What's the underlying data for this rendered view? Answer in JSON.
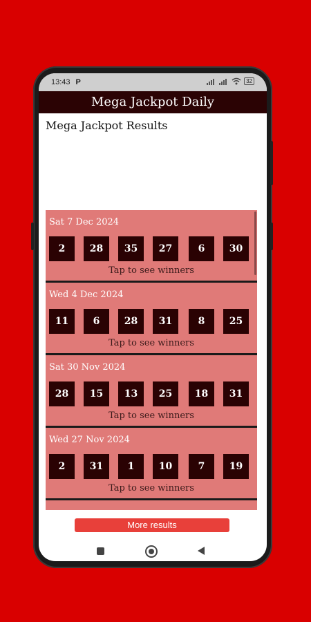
{
  "status_bar": {
    "time": "13:43",
    "indicator": "P",
    "battery": "32"
  },
  "app_bar": {
    "title": "Mega Jackpot Daily"
  },
  "main": {
    "section_title": "Mega Jackpot Results",
    "tap_hint": "Tap to see winners",
    "results": [
      {
        "date": "Sat 7 Dec 2024",
        "numbers": [
          "2",
          "28",
          "35",
          "27",
          "6",
          "30"
        ]
      },
      {
        "date": "Wed 4 Dec 2024",
        "numbers": [
          "11",
          "6",
          "28",
          "31",
          "8",
          "25"
        ]
      },
      {
        "date": "Sat 30 Nov 2024",
        "numbers": [
          "28",
          "15",
          "13",
          "25",
          "18",
          "31"
        ]
      },
      {
        "date": "Wed 27 Nov 2024",
        "numbers": [
          "2",
          "31",
          "1",
          "10",
          "7",
          "19"
        ]
      }
    ]
  },
  "footer": {
    "more_button_label": "More results"
  },
  "colors": {
    "background": "#d90000",
    "app_bar": "#2b0304",
    "card": "#e07a78",
    "ball": "#2a0203",
    "button": "#e8403a"
  }
}
